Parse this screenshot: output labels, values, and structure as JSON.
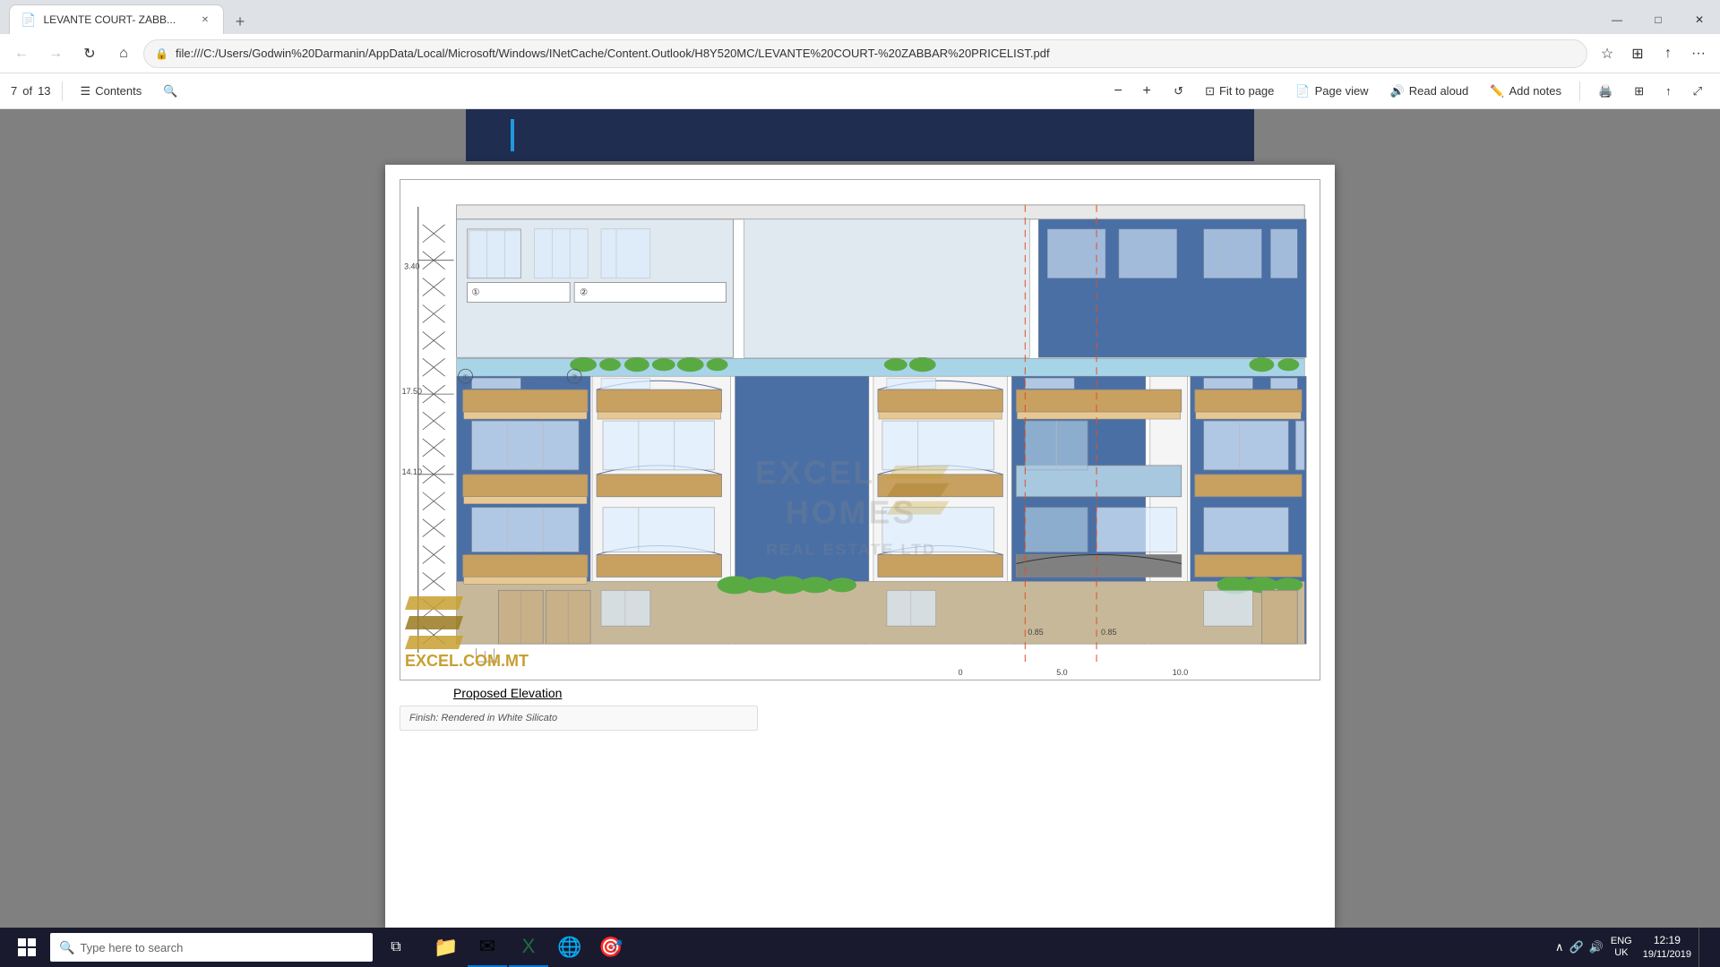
{
  "browser": {
    "tab": {
      "title": "LEVANTE COURT- ZABB...",
      "favicon": "📄"
    },
    "address": "file:///C:/Users/Godwin%20Darmanin/AppData/Local/Microsoft/Windows/INetCache/Content.Outlook/H8Y520MC/LEVANTE%20COURT-%20ZABBAR%20PRICELIST.pdf",
    "controls": {
      "minimize": "—",
      "maximize": "□",
      "close": "✕"
    }
  },
  "pdf_toolbar": {
    "page_current": "7",
    "page_total": "13",
    "contents_label": "Contents",
    "fit_to_page_label": "Fit to page",
    "page_view_label": "Page view",
    "read_aloud_label": "Read aloud",
    "add_notes_label": "Add notes"
  },
  "pdf_page": {
    "label": "Proposed Elevation",
    "legend_text": "Finish: Rendered in White Silicato"
  },
  "taskbar": {
    "search_placeholder": "Type here to search",
    "language": "ENG\nUK",
    "time": "12:19",
    "date": "19/11/2019",
    "apps": [
      "⊞",
      "📁",
      "✉",
      "📊",
      "🌐",
      "🎯"
    ]
  },
  "watermark": {
    "line1": "EXCEL",
    "line2": "HOMES",
    "line3": "REAL ESTATE LTD"
  },
  "corner_logo": {
    "text": "EXCEL.COM.MT"
  },
  "dimensions": {
    "d1": "3.40",
    "d2": "17.50",
    "d3": "14.10",
    "d4": "0.85",
    "d5": "0.85",
    "d6": "5.0",
    "d7": "10.0"
  }
}
